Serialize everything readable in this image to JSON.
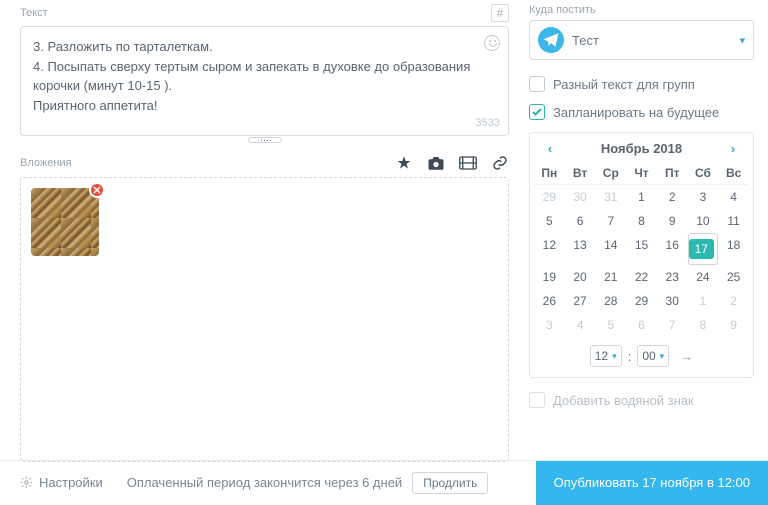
{
  "text_section": {
    "label": "Текст",
    "hash": "#",
    "content": "3. Разложить по тарталеткам.\n4. Посыпать сверху тертым сыром и запекать в духовке до образования корочки (минут 10-15 ).\nПриятного аппетита!",
    "counter": "3533"
  },
  "attachments": {
    "label": "Вложения"
  },
  "destination": {
    "label": "Куда постить",
    "selected": "Тест"
  },
  "options": {
    "diff_text": "Разный текст для групп",
    "schedule": "Запланировать на будущее",
    "watermark": "Добавить водяной знак"
  },
  "calendar": {
    "title": "Ноябрь 2018",
    "days": [
      "Пн",
      "Вт",
      "Ср",
      "Чт",
      "Пт",
      "Сб",
      "Вс"
    ],
    "weeks": [
      [
        {
          "n": "29",
          "m": 1
        },
        {
          "n": "30",
          "m": 1
        },
        {
          "n": "31",
          "m": 1
        },
        {
          "n": "1"
        },
        {
          "n": "2"
        },
        {
          "n": "3"
        },
        {
          "n": "4"
        }
      ],
      [
        {
          "n": "5"
        },
        {
          "n": "6"
        },
        {
          "n": "7"
        },
        {
          "n": "8"
        },
        {
          "n": "9"
        },
        {
          "n": "10"
        },
        {
          "n": "11"
        }
      ],
      [
        {
          "n": "12"
        },
        {
          "n": "13"
        },
        {
          "n": "14"
        },
        {
          "n": "15"
        },
        {
          "n": "16"
        },
        {
          "n": "17",
          "s": 1
        },
        {
          "n": "18"
        }
      ],
      [
        {
          "n": "19"
        },
        {
          "n": "20"
        },
        {
          "n": "21"
        },
        {
          "n": "22"
        },
        {
          "n": "23"
        },
        {
          "n": "24"
        },
        {
          "n": "25"
        }
      ],
      [
        {
          "n": "26"
        },
        {
          "n": "27"
        },
        {
          "n": "28"
        },
        {
          "n": "29"
        },
        {
          "n": "30"
        },
        {
          "n": "1",
          "m": 1
        },
        {
          "n": "2",
          "m": 1
        }
      ],
      [
        {
          "n": "3",
          "m": 1
        },
        {
          "n": "4",
          "m": 1
        },
        {
          "n": "5",
          "m": 1
        },
        {
          "n": "6",
          "m": 1
        },
        {
          "n": "7",
          "m": 1
        },
        {
          "n": "8",
          "m": 1
        },
        {
          "n": "9",
          "m": 1
        }
      ]
    ],
    "hour": "12",
    "minute": "00"
  },
  "footer": {
    "settings": "Настройки",
    "paid": "Оплаченный период закончится через 6 дней",
    "extend": "Продлить",
    "publish": "Опубликовать 17 ноября в 12:00"
  }
}
